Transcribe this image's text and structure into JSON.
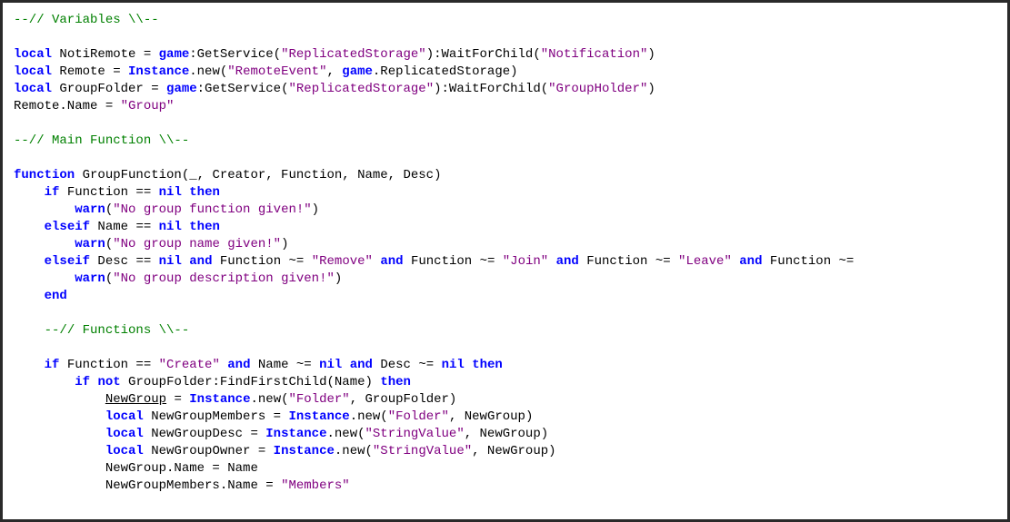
{
  "code": {
    "lines": [
      [
        {
          "cls": "tk-comment",
          "text": "--// Variables \\\\--"
        }
      ],
      [],
      [
        {
          "cls": "tk-keyword",
          "text": "local"
        },
        {
          "text": " NotiRemote = "
        },
        {
          "cls": "tk-global",
          "text": "game"
        },
        {
          "text": ":GetService("
        },
        {
          "cls": "tk-string",
          "text": "\"ReplicatedStorage\""
        },
        {
          "text": "):WaitForChild("
        },
        {
          "cls": "tk-string",
          "text": "\"Notification\""
        },
        {
          "text": ")"
        }
      ],
      [
        {
          "cls": "tk-keyword",
          "text": "local"
        },
        {
          "text": " Remote = "
        },
        {
          "cls": "tk-global",
          "text": "Instance"
        },
        {
          "text": ".new("
        },
        {
          "cls": "tk-string",
          "text": "\"RemoteEvent\""
        },
        {
          "text": ", "
        },
        {
          "cls": "tk-global",
          "text": "game"
        },
        {
          "text": ".ReplicatedStorage)"
        }
      ],
      [
        {
          "cls": "tk-keyword",
          "text": "local"
        },
        {
          "text": " GroupFolder = "
        },
        {
          "cls": "tk-global",
          "text": "game"
        },
        {
          "text": ":GetService("
        },
        {
          "cls": "tk-string",
          "text": "\"ReplicatedStorage\""
        },
        {
          "text": "):WaitForChild("
        },
        {
          "cls": "tk-string",
          "text": "\"GroupHolder\""
        },
        {
          "text": ")"
        }
      ],
      [
        {
          "text": "Remote.Name = "
        },
        {
          "cls": "tk-string",
          "text": "\"Group\""
        }
      ],
      [],
      [
        {
          "cls": "tk-comment",
          "text": "--// Main Function \\\\--"
        }
      ],
      [],
      [
        {
          "cls": "tk-keyword",
          "text": "function"
        },
        {
          "text": " GroupFunction(_, Creator, Function, Name, Desc)"
        }
      ],
      [
        {
          "text": "    "
        },
        {
          "cls": "tk-keyword",
          "text": "if"
        },
        {
          "text": " Function == "
        },
        {
          "cls": "tk-keyword",
          "text": "nil"
        },
        {
          "text": " "
        },
        {
          "cls": "tk-keyword",
          "text": "then"
        }
      ],
      [
        {
          "text": "        "
        },
        {
          "cls": "tk-global",
          "text": "warn"
        },
        {
          "text": "("
        },
        {
          "cls": "tk-string",
          "text": "\"No group function given!\""
        },
        {
          "text": ")"
        }
      ],
      [
        {
          "text": "    "
        },
        {
          "cls": "tk-keyword",
          "text": "elseif"
        },
        {
          "text": " Name == "
        },
        {
          "cls": "tk-keyword",
          "text": "nil"
        },
        {
          "text": " "
        },
        {
          "cls": "tk-keyword",
          "text": "then"
        }
      ],
      [
        {
          "text": "        "
        },
        {
          "cls": "tk-global",
          "text": "warn"
        },
        {
          "text": "("
        },
        {
          "cls": "tk-string",
          "text": "\"No group name given!\""
        },
        {
          "text": ")"
        }
      ],
      [
        {
          "text": "    "
        },
        {
          "cls": "tk-keyword",
          "text": "elseif"
        },
        {
          "text": " Desc == "
        },
        {
          "cls": "tk-keyword",
          "text": "nil"
        },
        {
          "text": " "
        },
        {
          "cls": "tk-keyword",
          "text": "and"
        },
        {
          "text": " Function ~= "
        },
        {
          "cls": "tk-string",
          "text": "\"Remove\""
        },
        {
          "text": " "
        },
        {
          "cls": "tk-keyword",
          "text": "and"
        },
        {
          "text": " Function ~= "
        },
        {
          "cls": "tk-string",
          "text": "\"Join\""
        },
        {
          "text": " "
        },
        {
          "cls": "tk-keyword",
          "text": "and"
        },
        {
          "text": " Function ~= "
        },
        {
          "cls": "tk-string",
          "text": "\"Leave\""
        },
        {
          "text": " "
        },
        {
          "cls": "tk-keyword",
          "text": "and"
        },
        {
          "text": " Function ~="
        }
      ],
      [
        {
          "text": "        "
        },
        {
          "cls": "tk-global",
          "text": "warn"
        },
        {
          "text": "("
        },
        {
          "cls": "tk-string",
          "text": "\"No group description given!\""
        },
        {
          "text": ")"
        }
      ],
      [
        {
          "text": "    "
        },
        {
          "cls": "tk-keyword",
          "text": "end"
        }
      ],
      [],
      [
        {
          "text": "    "
        },
        {
          "cls": "tk-comment",
          "text": "--// Functions \\\\--"
        }
      ],
      [],
      [
        {
          "text": "    "
        },
        {
          "cls": "tk-keyword",
          "text": "if"
        },
        {
          "text": " Function == "
        },
        {
          "cls": "tk-string",
          "text": "\"Create\""
        },
        {
          "text": " "
        },
        {
          "cls": "tk-keyword",
          "text": "and"
        },
        {
          "text": " Name ~= "
        },
        {
          "cls": "tk-keyword",
          "text": "nil"
        },
        {
          "text": " "
        },
        {
          "cls": "tk-keyword",
          "text": "and"
        },
        {
          "text": " Desc ~= "
        },
        {
          "cls": "tk-keyword",
          "text": "nil"
        },
        {
          "text": " "
        },
        {
          "cls": "tk-keyword",
          "text": "then"
        }
      ],
      [
        {
          "text": "        "
        },
        {
          "cls": "tk-keyword",
          "text": "if"
        },
        {
          "text": " "
        },
        {
          "cls": "tk-keyword",
          "text": "not"
        },
        {
          "text": " GroupFolder:FindFirstChild(Name) "
        },
        {
          "cls": "tk-keyword",
          "text": "then"
        }
      ],
      [
        {
          "text": "            "
        },
        {
          "cls": "tk-underline",
          "text": "NewGroup"
        },
        {
          "text": " = "
        },
        {
          "cls": "tk-global",
          "text": "Instance"
        },
        {
          "text": ".new("
        },
        {
          "cls": "tk-string",
          "text": "\"Folder\""
        },
        {
          "text": ", GroupFolder)"
        }
      ],
      [
        {
          "text": "            "
        },
        {
          "cls": "tk-keyword",
          "text": "local"
        },
        {
          "text": " NewGroupMembers = "
        },
        {
          "cls": "tk-global",
          "text": "Instance"
        },
        {
          "text": ".new("
        },
        {
          "cls": "tk-string",
          "text": "\"Folder\""
        },
        {
          "text": ", NewGroup)"
        }
      ],
      [
        {
          "text": "            "
        },
        {
          "cls": "tk-keyword",
          "text": "local"
        },
        {
          "text": " NewGroupDesc = "
        },
        {
          "cls": "tk-global",
          "text": "Instance"
        },
        {
          "text": ".new("
        },
        {
          "cls": "tk-string",
          "text": "\"StringValue\""
        },
        {
          "text": ", NewGroup)"
        }
      ],
      [
        {
          "text": "            "
        },
        {
          "cls": "tk-keyword",
          "text": "local"
        },
        {
          "text": " NewGroupOwner = "
        },
        {
          "cls": "tk-global",
          "text": "Instance"
        },
        {
          "text": ".new("
        },
        {
          "cls": "tk-string",
          "text": "\"StringValue\""
        },
        {
          "text": ", NewGroup)"
        }
      ],
      [
        {
          "text": "            NewGroup.Name = Name"
        }
      ],
      [
        {
          "text": "            NewGroupMembers.Name = "
        },
        {
          "cls": "tk-string",
          "text": "\"Members\""
        }
      ]
    ]
  }
}
